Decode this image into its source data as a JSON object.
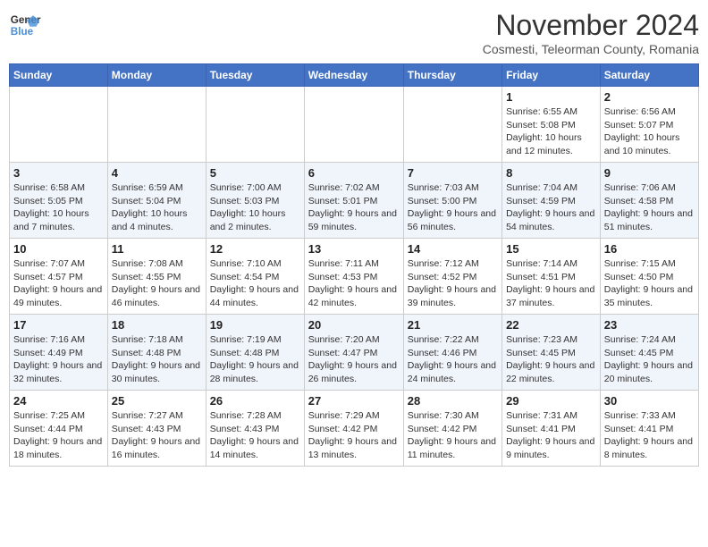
{
  "header": {
    "logo_line1": "General",
    "logo_line2": "Blue",
    "month_title": "November 2024",
    "location": "Cosmesti, Teleorman County, Romania"
  },
  "weekdays": [
    "Sunday",
    "Monday",
    "Tuesday",
    "Wednesday",
    "Thursday",
    "Friday",
    "Saturday"
  ],
  "weeks": [
    [
      {
        "day": "",
        "info": ""
      },
      {
        "day": "",
        "info": ""
      },
      {
        "day": "",
        "info": ""
      },
      {
        "day": "",
        "info": ""
      },
      {
        "day": "",
        "info": ""
      },
      {
        "day": "1",
        "info": "Sunrise: 6:55 AM\nSunset: 5:08 PM\nDaylight: 10 hours and 12 minutes."
      },
      {
        "day": "2",
        "info": "Sunrise: 6:56 AM\nSunset: 5:07 PM\nDaylight: 10 hours and 10 minutes."
      }
    ],
    [
      {
        "day": "3",
        "info": "Sunrise: 6:58 AM\nSunset: 5:05 PM\nDaylight: 10 hours and 7 minutes."
      },
      {
        "day": "4",
        "info": "Sunrise: 6:59 AM\nSunset: 5:04 PM\nDaylight: 10 hours and 4 minutes."
      },
      {
        "day": "5",
        "info": "Sunrise: 7:00 AM\nSunset: 5:03 PM\nDaylight: 10 hours and 2 minutes."
      },
      {
        "day": "6",
        "info": "Sunrise: 7:02 AM\nSunset: 5:01 PM\nDaylight: 9 hours and 59 minutes."
      },
      {
        "day": "7",
        "info": "Sunrise: 7:03 AM\nSunset: 5:00 PM\nDaylight: 9 hours and 56 minutes."
      },
      {
        "day": "8",
        "info": "Sunrise: 7:04 AM\nSunset: 4:59 PM\nDaylight: 9 hours and 54 minutes."
      },
      {
        "day": "9",
        "info": "Sunrise: 7:06 AM\nSunset: 4:58 PM\nDaylight: 9 hours and 51 minutes."
      }
    ],
    [
      {
        "day": "10",
        "info": "Sunrise: 7:07 AM\nSunset: 4:57 PM\nDaylight: 9 hours and 49 minutes."
      },
      {
        "day": "11",
        "info": "Sunrise: 7:08 AM\nSunset: 4:55 PM\nDaylight: 9 hours and 46 minutes."
      },
      {
        "day": "12",
        "info": "Sunrise: 7:10 AM\nSunset: 4:54 PM\nDaylight: 9 hours and 44 minutes."
      },
      {
        "day": "13",
        "info": "Sunrise: 7:11 AM\nSunset: 4:53 PM\nDaylight: 9 hours and 42 minutes."
      },
      {
        "day": "14",
        "info": "Sunrise: 7:12 AM\nSunset: 4:52 PM\nDaylight: 9 hours and 39 minutes."
      },
      {
        "day": "15",
        "info": "Sunrise: 7:14 AM\nSunset: 4:51 PM\nDaylight: 9 hours and 37 minutes."
      },
      {
        "day": "16",
        "info": "Sunrise: 7:15 AM\nSunset: 4:50 PM\nDaylight: 9 hours and 35 minutes."
      }
    ],
    [
      {
        "day": "17",
        "info": "Sunrise: 7:16 AM\nSunset: 4:49 PM\nDaylight: 9 hours and 32 minutes."
      },
      {
        "day": "18",
        "info": "Sunrise: 7:18 AM\nSunset: 4:48 PM\nDaylight: 9 hours and 30 minutes."
      },
      {
        "day": "19",
        "info": "Sunrise: 7:19 AM\nSunset: 4:48 PM\nDaylight: 9 hours and 28 minutes."
      },
      {
        "day": "20",
        "info": "Sunrise: 7:20 AM\nSunset: 4:47 PM\nDaylight: 9 hours and 26 minutes."
      },
      {
        "day": "21",
        "info": "Sunrise: 7:22 AM\nSunset: 4:46 PM\nDaylight: 9 hours and 24 minutes."
      },
      {
        "day": "22",
        "info": "Sunrise: 7:23 AM\nSunset: 4:45 PM\nDaylight: 9 hours and 22 minutes."
      },
      {
        "day": "23",
        "info": "Sunrise: 7:24 AM\nSunset: 4:45 PM\nDaylight: 9 hours and 20 minutes."
      }
    ],
    [
      {
        "day": "24",
        "info": "Sunrise: 7:25 AM\nSunset: 4:44 PM\nDaylight: 9 hours and 18 minutes."
      },
      {
        "day": "25",
        "info": "Sunrise: 7:27 AM\nSunset: 4:43 PM\nDaylight: 9 hours and 16 minutes."
      },
      {
        "day": "26",
        "info": "Sunrise: 7:28 AM\nSunset: 4:43 PM\nDaylight: 9 hours and 14 minutes."
      },
      {
        "day": "27",
        "info": "Sunrise: 7:29 AM\nSunset: 4:42 PM\nDaylight: 9 hours and 13 minutes."
      },
      {
        "day": "28",
        "info": "Sunrise: 7:30 AM\nSunset: 4:42 PM\nDaylight: 9 hours and 11 minutes."
      },
      {
        "day": "29",
        "info": "Sunrise: 7:31 AM\nSunset: 4:41 PM\nDaylight: 9 hours and 9 minutes."
      },
      {
        "day": "30",
        "info": "Sunrise: 7:33 AM\nSunset: 4:41 PM\nDaylight: 9 hours and 8 minutes."
      }
    ]
  ]
}
